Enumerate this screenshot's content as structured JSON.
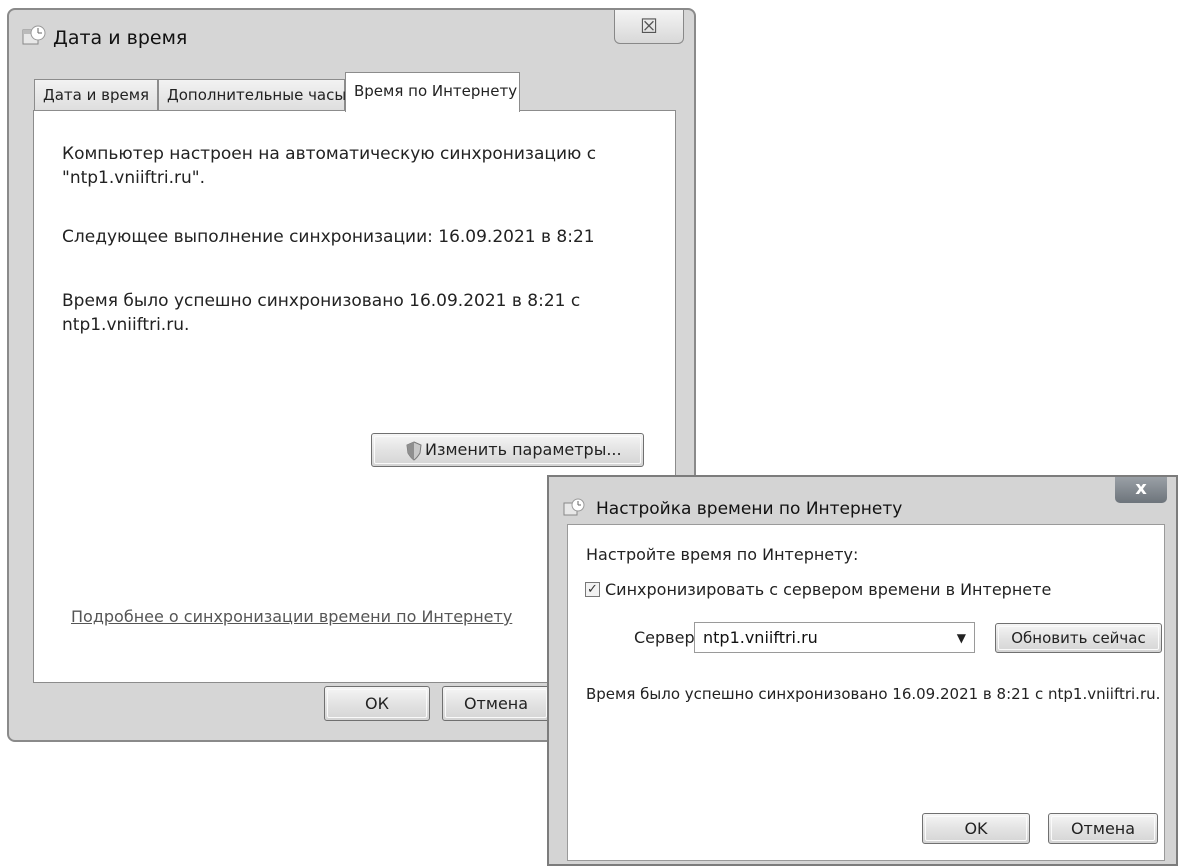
{
  "main_dialog": {
    "title": "Дата и время",
    "close_glyph": "☒",
    "tabs": [
      {
        "label": "Дата и время"
      },
      {
        "label": "Дополнительные часы"
      },
      {
        "label": "Время по Интернету"
      }
    ],
    "active_tab": 2,
    "sync_text_line1": "Компьютер настроен на автоматическую синхронизацию с",
    "sync_text_line2": "\"ntp1.vniiftri.ru\".",
    "next_sync_text": "Следующее выполнение синхронизации: 16.09.2021 в 8:21",
    "last_sync_text": "Время было успешно синхронизовано 16.09.2021 в 8:21 с ntp1.vniiftri.ru.",
    "change_settings_label": "Изменить параметры...",
    "more_info_link": "Подробнее о синхронизации времени по Интернету",
    "ok_label": "ОК",
    "cancel_label": "Отмена"
  },
  "inet_dialog": {
    "title": "Настройка времени по Интернету",
    "close_glyph": "x",
    "heading": "Настройте время по Интернету:",
    "sync_checkbox_label": "Синхронизировать с сервером времени в Интернете",
    "sync_checked": true,
    "server_label": "Сервер:",
    "server_value": "ntp1.vniiftri.ru",
    "update_now_label": "Обновить сейчас",
    "status_text": "Время было успешно синхронизовано 16.09.2021 в 8:21 с ntp1.vniiftri.ru.",
    "ok_label": "OK",
    "cancel_label": "Отмена"
  }
}
